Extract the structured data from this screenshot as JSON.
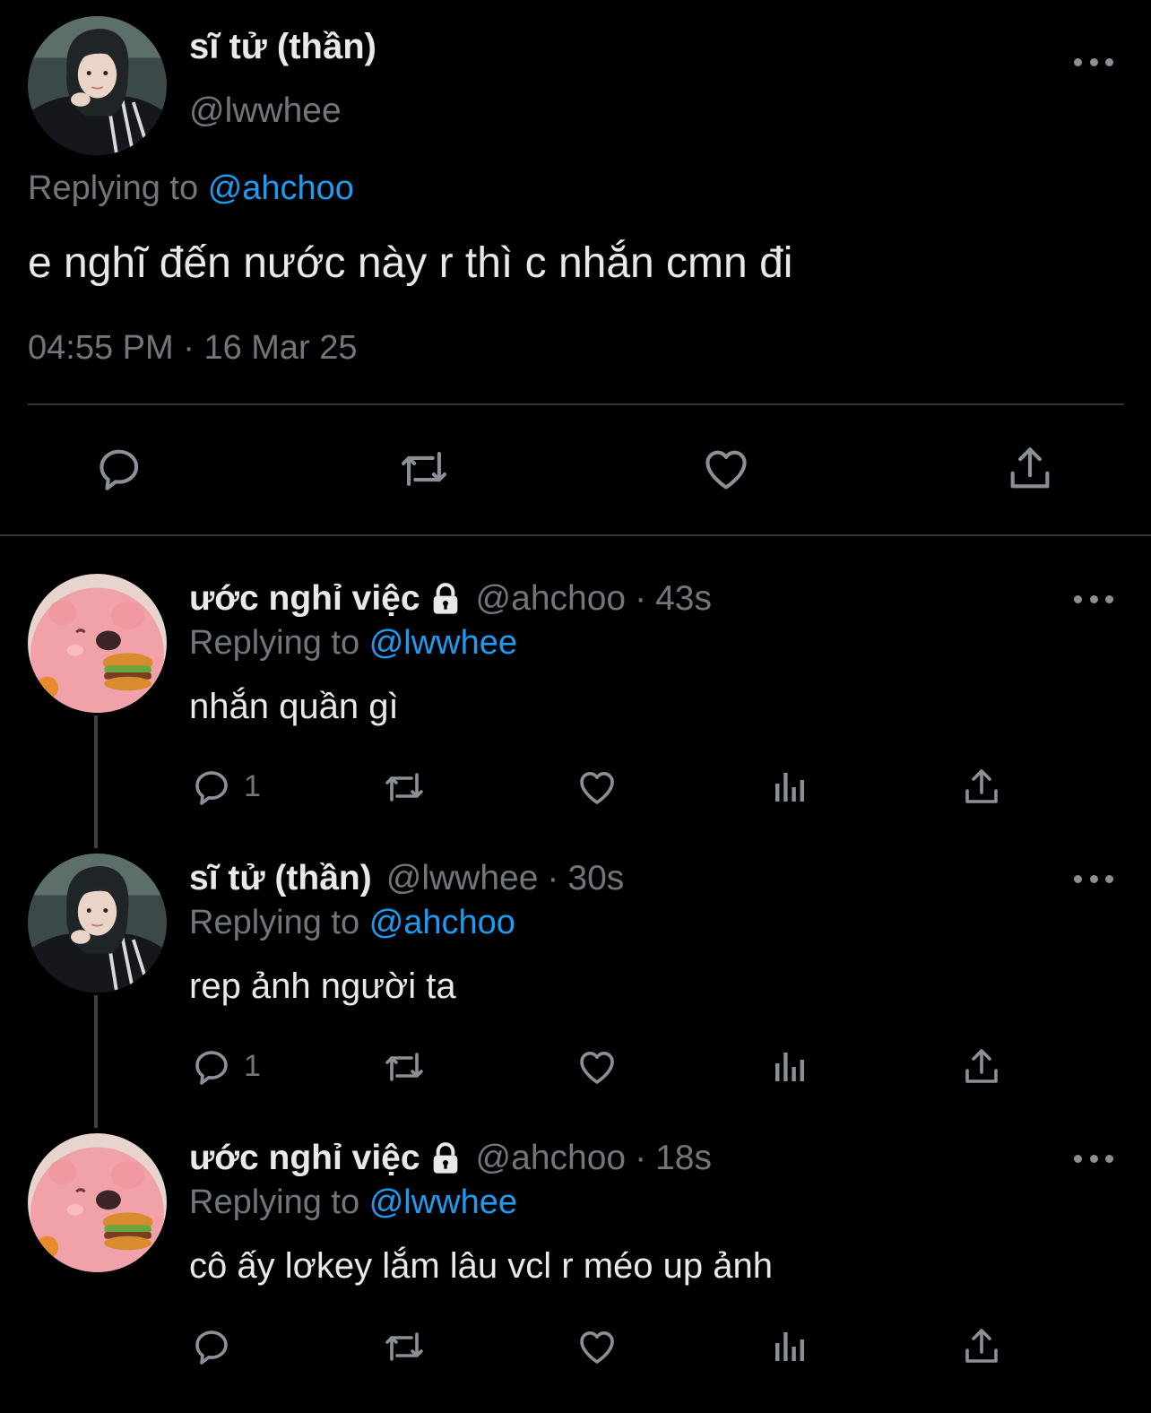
{
  "main_tweet": {
    "author_name": "sĩ tử (thần)",
    "author_handle": "@lwwhee",
    "replying_prefix": "Replying to",
    "replying_to": "@ahchoo",
    "text": "e nghĩ đến nước này r thì c nhắn cmn đi",
    "time": "04:55 PM",
    "separator": "·",
    "date": "16 Mar 25",
    "actions": [
      "reply-icon",
      "retweet-icon",
      "like-icon",
      "share-icon"
    ]
  },
  "replies": [
    {
      "author_name": "ước nghỉ việc",
      "locked": true,
      "author_handle": "@ahchoo",
      "separator": "·",
      "time": "43s",
      "replying_prefix": "Replying to",
      "replying_to": "@lwwhee",
      "text": "nhắn quần gì",
      "reply_count": "1",
      "avatar": "pink-character"
    },
    {
      "author_name": "sĩ tử (thần)",
      "locked": false,
      "author_handle": "@lwwhee",
      "separator": "·",
      "time": "30s",
      "replying_prefix": "Replying to",
      "replying_to": "@ahchoo",
      "text": "rep ảnh người ta",
      "reply_count": "1",
      "avatar": "girl-photo"
    },
    {
      "author_name": "ước nghỉ việc",
      "locked": true,
      "author_handle": "@ahchoo",
      "separator": "·",
      "time": "18s",
      "replying_prefix": "Replying to",
      "replying_to": "@lwwhee",
      "text": "cô ấy lơkey lắm lâu vcl r méo up ảnh",
      "reply_count": "",
      "avatar": "pink-character"
    }
  ],
  "colors": {
    "background": "#000000",
    "primary_text": "#e7e9ea",
    "secondary_text": "#71767b",
    "link": "#1d9bf0",
    "divider": "#2f3336"
  }
}
